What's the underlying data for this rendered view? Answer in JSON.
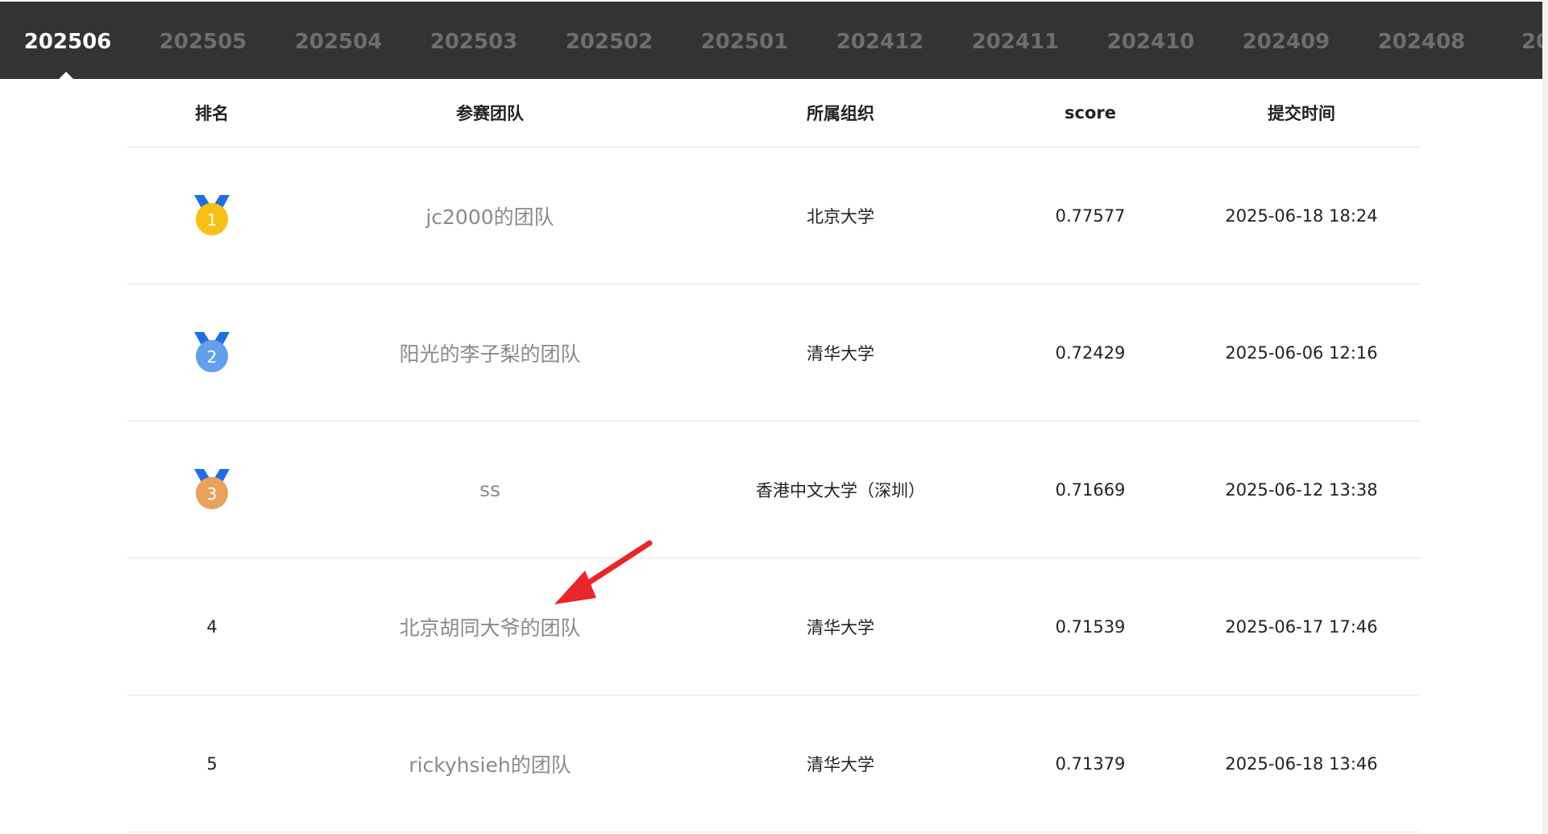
{
  "tabs": [
    {
      "label": "202506",
      "active": true
    },
    {
      "label": "202505"
    },
    {
      "label": "202504"
    },
    {
      "label": "202503"
    },
    {
      "label": "202502"
    },
    {
      "label": "202501"
    },
    {
      "label": "202412"
    },
    {
      "label": "202411"
    },
    {
      "label": "202410"
    },
    {
      "label": "202409"
    },
    {
      "label": "202408"
    },
    {
      "label": "20"
    }
  ],
  "table": {
    "headers": {
      "rank": "排名",
      "team": "参赛团队",
      "org": "所属组织",
      "score": "score",
      "time": "提交时间"
    },
    "rows": [
      {
        "rank": "1",
        "medal": "gold",
        "team": "jc2000的团队",
        "org": "北京大学",
        "score": "0.77577",
        "time": "2025-06-18 18:24"
      },
      {
        "rank": "2",
        "medal": "silver",
        "team": "阳光的李子梨的团队",
        "org": "清华大学",
        "score": "0.72429",
        "time": "2025-06-06 12:16"
      },
      {
        "rank": "3",
        "medal": "bronze",
        "team": "ss",
        "org": "香港中文大学（深圳）",
        "score": "0.71669",
        "time": "2025-06-12 13:38"
      },
      {
        "rank": "4",
        "team": "北京胡同大爷的团队",
        "org": "清华大学",
        "score": "0.71539",
        "time": "2025-06-17 17:46"
      },
      {
        "rank": "5",
        "team": "rickyhsieh的团队",
        "org": "清华大学",
        "score": "0.71379",
        "time": "2025-06-18 13:46"
      }
    ]
  },
  "colors": {
    "tabbar_bg": "#333333",
    "tab_inactive": "#6e6e6e",
    "tab_active": "#ffffff",
    "medal_ribbon": "#1f6fe0",
    "gold": "#f5b800",
    "silver": "#4a8fe0",
    "bronze": "#e0964a",
    "annotation_arrow": "#e8262b"
  },
  "icons": {
    "medal": "medal-icon",
    "annotation": "red-arrow-annotation"
  }
}
